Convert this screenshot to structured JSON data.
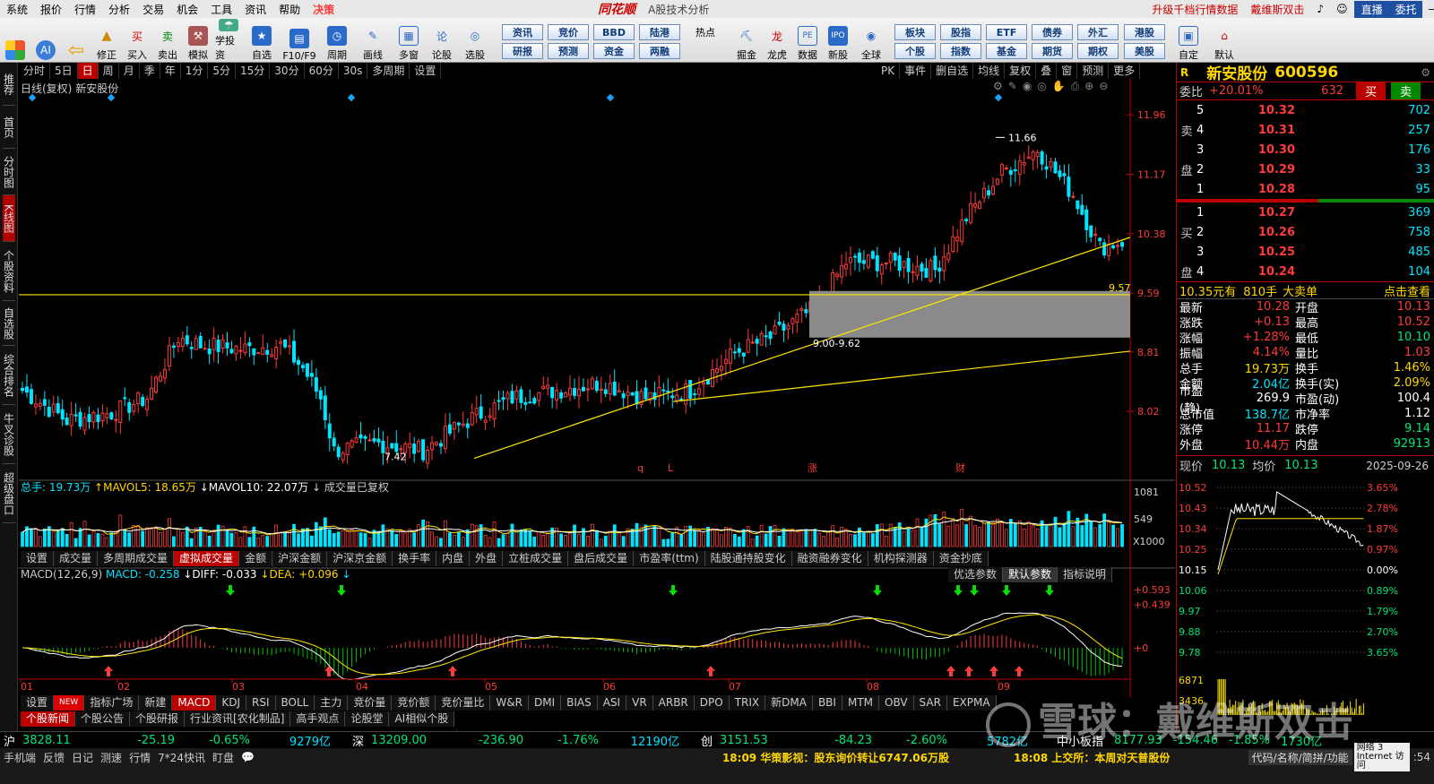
{
  "menu": {
    "items": [
      "系统",
      "报价",
      "行情",
      "分析",
      "交易",
      "机会",
      "工具",
      "资讯",
      "帮助",
      "决策"
    ],
    "brand": "同花顺",
    "subtitle": "A股技术分析",
    "ads": [
      "升级千档行情数据",
      "戴维斯双击"
    ],
    "direct": "直播",
    "wt": "委托"
  },
  "toolbar": {
    "tools": [
      "修正",
      "买入",
      "卖出",
      "模拟",
      "学投资",
      "自选",
      "F10/F9",
      "周期",
      "画线",
      "多窗",
      "论股",
      "选股",
      "热点",
      "掘金",
      "龙虎",
      "数据",
      "新股",
      "全球",
      "自定",
      "默认"
    ],
    "quick": [
      [
        "资讯",
        "竞价",
        "BBD",
        "陆港",
        "板块",
        "股指",
        "ETF",
        "债券",
        "外汇",
        "港股"
      ],
      [
        "研报",
        "预测",
        "资金",
        "两融",
        "个股",
        "指数",
        "基金",
        "期货",
        "期权",
        "美股"
      ]
    ]
  },
  "leftnav": [
    "推荐",
    "首页",
    "分时图",
    "K线图",
    "个股资料",
    "自选股",
    "综合排名",
    "牛叉诊股",
    "超级盘口"
  ],
  "period_tabs": [
    "分时",
    "5日",
    "日",
    "周",
    "月",
    "季",
    "年",
    "1分",
    "5分",
    "15分",
    "30分",
    "60分",
    "30s",
    "多周期",
    "设置"
  ],
  "chart_tools": [
    "PK",
    "事件",
    "删自选",
    "均线",
    "复权",
    "叠",
    "窗",
    "预测",
    "更多"
  ],
  "chart_title": [
    "日线(复权)",
    "新安股份"
  ],
  "price_axis": [
    "11.96",
    "11.17",
    "10.38",
    "9.59",
    "8.81",
    "8.02"
  ],
  "annotations": {
    "high": "11.66",
    "low": "7.42",
    "level": "9.57",
    "zone": "9.00-9.62",
    "marks": [
      "q",
      "L",
      "涨",
      "财"
    ]
  },
  "vol_line": {
    "a": "总手: 19.73万",
    "b": "MAVOL5: 18.65万",
    "c": "MAVOL10: 22.07万",
    "d": "成交量已复权"
  },
  "vol_axis": [
    "1081",
    "549",
    "X1000"
  ],
  "ind_tabs": [
    "设置",
    "成交量",
    "多周期成交量",
    "虚拟成交量",
    "金额",
    "沪深金额",
    "沪深京金额",
    "换手率",
    "内盘",
    "外盘",
    "立桩成交量",
    "盘后成交量",
    "市盈率(ttm)",
    "陆股通持股变化",
    "融资融券变化",
    "机构探测器",
    "资金抄底"
  ],
  "macd_line": {
    "a": "MACD(12,26,9)",
    "b": "MACD: -0.258",
    "c": "DIFF: -0.033",
    "d": "DEA: +0.096"
  },
  "macd_btns": [
    "优选参数",
    "默认参数",
    "指标说明"
  ],
  "macd_axis": [
    "+0.593",
    "+0.439",
    "+0"
  ],
  "months": [
    "01",
    "02",
    "03",
    "04",
    "05",
    "06",
    "07",
    "08",
    "09"
  ],
  "bot_tabs": [
    "设置",
    "NEW",
    "指标广场",
    "新建",
    "MACD",
    "KDJ",
    "RSI",
    "BOLL",
    "主力",
    "竞价量",
    "竞价额",
    "竞价量比",
    "W&R",
    "DMI",
    "BIAS",
    "ASI",
    "VR",
    "ARBR",
    "DPO",
    "TRIX",
    "新DMA",
    "BBI",
    "MTM",
    "OBV",
    "SAR",
    "EXPMA"
  ],
  "news_tabs": [
    "个股新闻",
    "个股公告",
    "个股研报",
    "行业资讯[农化制品]",
    "高手观点",
    "论股堂",
    "AI相似个股"
  ],
  "stock": {
    "name": "新安股份",
    "code": "600596",
    "r": "R",
    "wb_label": "委比",
    "wb": "+20.01%",
    "wc": "632",
    "buy": "买",
    "sell": "卖",
    "asks": [
      [
        "5",
        "10.32",
        "702"
      ],
      [
        "4",
        "10.31",
        "257"
      ],
      [
        "3",
        "10.30",
        "176"
      ],
      [
        "2",
        "10.29",
        "33"
      ],
      [
        "1",
        "10.28",
        "95"
      ]
    ],
    "bids": [
      [
        "1",
        "10.27",
        "369"
      ],
      [
        "2",
        "10.26",
        "758"
      ],
      [
        "3",
        "10.25",
        "485"
      ],
      [
        "4",
        "10.24",
        "104"
      ]
    ],
    "sell_lbl": [
      "卖",
      "盘"
    ],
    "buy_lbl": [
      "买",
      "盘"
    ],
    "trade": [
      "10.35元有",
      "810手",
      "大卖单",
      "点击查看"
    ],
    "info": [
      [
        "最新",
        "10.28",
        "开盘",
        "10.13"
      ],
      [
        "涨跌",
        "+0.13",
        "最高",
        "10.52"
      ],
      [
        "涨幅",
        "+1.28%",
        "最低",
        "10.10"
      ],
      [
        "振幅",
        "4.14%",
        "量比",
        "1.03"
      ],
      [
        "总手",
        "19.73万",
        "换手",
        "1.46%"
      ],
      [
        "金额",
        "2.04亿",
        "换手(实)",
        "2.09%"
      ],
      [
        "市盈(静)",
        "269.9",
        "市盈(动)",
        "100.4"
      ],
      [
        "总市值",
        "138.7亿",
        "市净率",
        "1.12"
      ],
      [
        "涨停",
        "11.17",
        "跌停",
        "9.14"
      ],
      [
        "外盘",
        "10.44万",
        "内盘",
        "92913"
      ]
    ],
    "now_lbl": "现价",
    "now": "10.13",
    "avg_lbl": "均价",
    "avg": "10.13",
    "date": "2025-09-26",
    "mini_left": [
      "10.52",
      "10.43",
      "10.34",
      "10.25",
      "10.15",
      "10.06",
      "9.97",
      "9.88",
      "9.78",
      "6871",
      "3436"
    ],
    "mini_right": [
      "3.65%",
      "2.78%",
      "1.87%",
      "0.97%",
      "0.00%",
      "0.89%",
      "1.79%",
      "2.70%",
      "3.65%"
    ]
  },
  "status": [
    [
      "沪",
      "3828.11",
      "-25.19",
      "-0.65%",
      "9279亿"
    ],
    [
      "深",
      "13209.00",
      "-236.90",
      "-1.76%",
      "12190亿"
    ],
    [
      "创",
      "3151.53",
      "-84.23",
      "-2.60%",
      "5782亿"
    ]
  ],
  "status_extra": [
    "中小板指",
    "8177.93",
    "-154.46",
    "-1.85%",
    "1730亿"
  ],
  "bottom": {
    "items": [
      "手机端",
      "反馈",
      "日记",
      "测速",
      "行情",
      "7*24快讯",
      "盯盘"
    ],
    "news1": "18:09 华策影视：股东询价转让6747.06万股",
    "news2": "18:08 上交所：本周对天普股份",
    "right": [
      "代码/名称/简拼/功能",
      "网络",
      "3",
      "Internet 访问"
    ],
    "time": ":54"
  },
  "watermark": "雪球：戴维斯双击"
}
